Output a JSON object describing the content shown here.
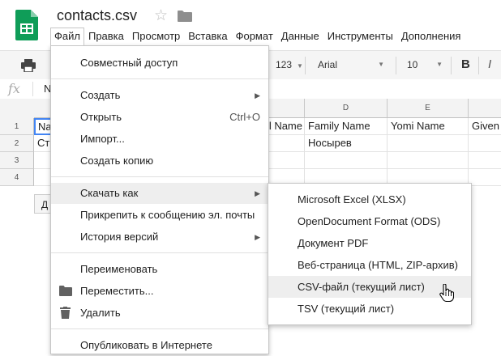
{
  "doc": {
    "title": "contacts.csv"
  },
  "menubar": [
    "Файл",
    "Правка",
    "Просмотр",
    "Вставка",
    "Формат",
    "Данные",
    "Инструменты",
    "Дополнения"
  ],
  "toolbar": {
    "number_format": "123",
    "font": "Arial",
    "size": "10",
    "bold": "B"
  },
  "formula_bar": {
    "fx": "fx",
    "value": "N"
  },
  "columns": [
    {
      "letter": ""
    },
    {
      "letter": ""
    },
    {
      "letter": "D"
    },
    {
      "letter": "E"
    },
    {
      "letter": ""
    }
  ],
  "rows": [
    {
      "num": "1",
      "a": "Na",
      "c": "l Name",
      "d": "Family Name",
      "e": "Yomi Name",
      "f": "Given"
    },
    {
      "num": "2",
      "a": "Ст",
      "c": "",
      "d": "Носырев",
      "e": "",
      "f": ""
    },
    {
      "num": "3",
      "a": "",
      "c": "",
      "d": "",
      "e": "",
      "f": ""
    },
    {
      "num": "4",
      "a": "",
      "c": "",
      "d": "",
      "e": "",
      "f": ""
    }
  ],
  "sheet_button": "Д",
  "file_menu": {
    "share": "Совместный доступ",
    "new": "Создать",
    "open": "Открыть",
    "open_shortcut": "Ctrl+O",
    "import": "Импорт...",
    "copy": "Создать копию",
    "download": "Скачать как",
    "email": "Прикрепить к сообщению эл. почты",
    "history": "История версий",
    "rename": "Переименовать",
    "move": "Переместить...",
    "delete": "Удалить",
    "publish": "Опубликовать в Интернете"
  },
  "download_menu": [
    "Microsoft Excel (XLSX)",
    "OpenDocument Format (ODS)",
    "Документ PDF",
    "Веб-страница (HTML, ZIP-архив)",
    "CSV-файл (текущий лист)",
    "TSV (текущий лист)"
  ],
  "colors": {
    "sheets_green": "#0f9d58",
    "highlight": "#eeeeee"
  }
}
